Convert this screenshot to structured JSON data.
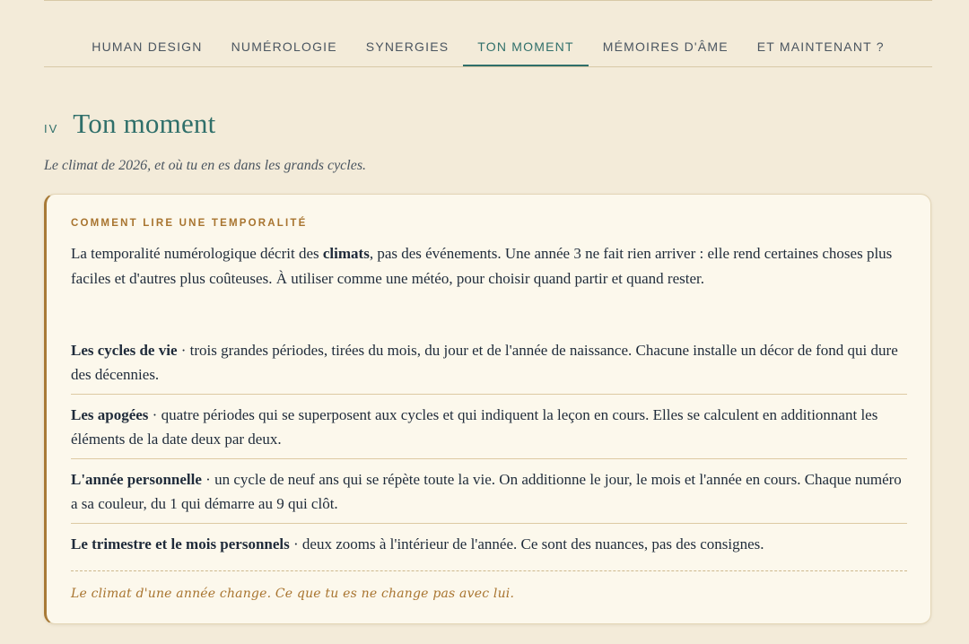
{
  "nav": {
    "items": [
      {
        "label": "HUMAN DESIGN"
      },
      {
        "label": "NUMÉROLOGIE"
      },
      {
        "label": "SYNERGIES"
      },
      {
        "label": "TON MOMENT",
        "active": true
      },
      {
        "label": "MÉMOIRES D'ÂME"
      },
      {
        "label": "ET MAINTENANT ?"
      }
    ]
  },
  "section": {
    "numeral": "IV",
    "title": "Ton moment",
    "subtitle": "Le climat de 2026, et où tu en es dans les grands cycles."
  },
  "card": {
    "eyebrow": "COMMENT LIRE UNE TEMPORALITÉ",
    "intro": {
      "before": "La temporalité numérologique décrit des ",
      "emphasis": "climats",
      "after": ", pas des événements. Une année 3 ne fait rien arriver : elle rend certaines choses plus faciles et d'autres plus coûteuses. À utiliser comme une météo, pour choisir quand partir et quand rester."
    },
    "items": [
      {
        "term": "Les cycles de vie",
        "text": " · trois grandes périodes, tirées du mois, du jour et de l'année de naissance. Chacune installe un décor de fond qui dure des décennies."
      },
      {
        "term": "Les apogées",
        "text": " · quatre périodes qui se superposent aux cycles et qui indiquent la leçon en cours. Elles se calculent en additionnant les éléments de la date deux par deux."
      },
      {
        "term": "L'année personnelle",
        "text": " · un cycle de neuf ans qui se répète toute la vie. On additionne le jour, le mois et l'année en cours. Chaque numéro a sa couleur, du 1 qui démarre au 9 qui clôt."
      },
      {
        "term": "Le trimestre et le mois personnels",
        "text": " · deux zooms à l'intérieur de l'année. Ce sont des nuances, pas des consignes."
      }
    ],
    "footnote": "Le climat d'une année change. Ce que tu es ne change pas avec lui."
  },
  "colors": {
    "background": "#f3ebd9",
    "card": "#fcf8ec",
    "accent_teal": "#2f6f6a",
    "accent_gold": "#a8742f",
    "text": "#1f2b3a"
  }
}
